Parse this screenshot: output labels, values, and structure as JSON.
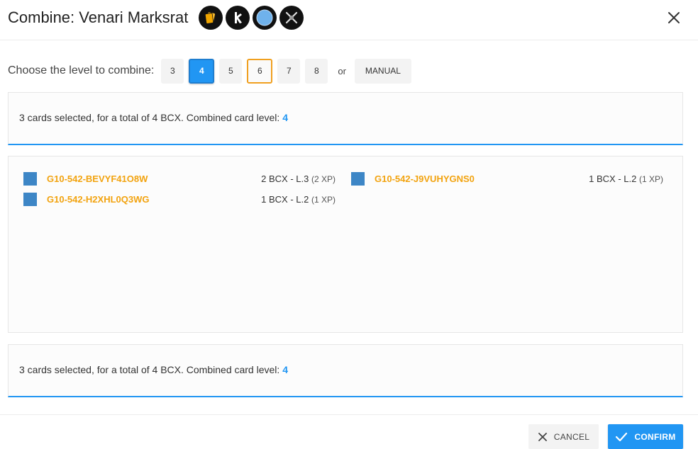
{
  "dialog": {
    "title": "Combine: Venari Marksrat",
    "badges": [
      "card-rarity-icon",
      "splinter-icon",
      "element-icon",
      "ability-icon"
    ]
  },
  "level_selector": {
    "label": "Choose the level to combine:",
    "levels": [
      "3",
      "4",
      "5",
      "6",
      "7",
      "8"
    ],
    "selected": "4",
    "highlighted": "6",
    "or_text": "or",
    "manual_label": "MANUAL"
  },
  "summary": {
    "text": "3 cards selected, for a total of 4 BCX. Combined card level:",
    "level": "4"
  },
  "cards": [
    {
      "id": "G10-542-BEVYF41O8W",
      "bcx": "2 BCX - L.3",
      "xp": "(2 XP)"
    },
    {
      "id": "G10-542-J9VUHYGNS0",
      "bcx": "1 BCX - L.2",
      "xp": "(1 XP)"
    },
    {
      "id": "G10-542-H2XHL0Q3WG",
      "bcx": "1 BCX - L.2",
      "xp": "(1 XP)"
    }
  ],
  "footer": {
    "cancel_label": "CANCEL",
    "confirm_label": "CONFIRM"
  },
  "colors": {
    "accent": "#2196f3",
    "card_id": "#f2a30f",
    "highlight_border": "#f0a020",
    "checkbox": "#3d86c6"
  }
}
